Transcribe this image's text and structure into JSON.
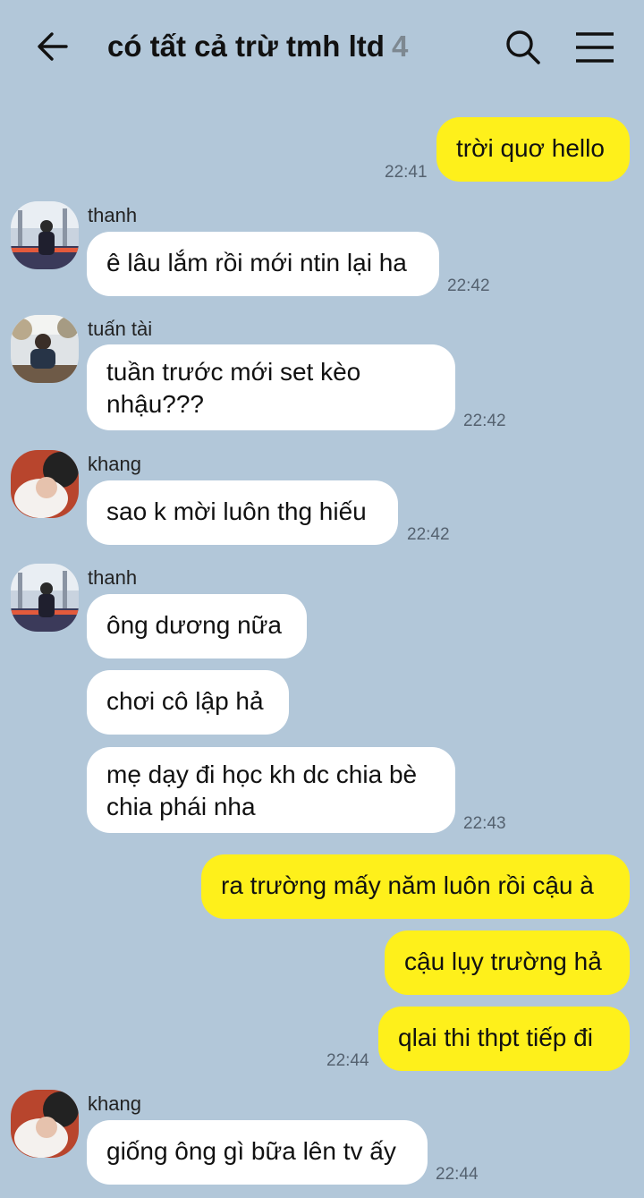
{
  "header": {
    "title": "có tất cả trừ tmh ltd",
    "member_count": "4"
  },
  "messages": [
    {
      "sender": "",
      "text": "trời quơ hello",
      "time": "22:41"
    },
    {
      "sender": "thanh",
      "text": "ê lâu lắm rồi mới ntin lại ha",
      "time": "22:42"
    },
    {
      "sender": "tuấn tài",
      "text": "tuần trước mới set kèo\nnhậu???",
      "time": "22:42"
    },
    {
      "sender": "khang",
      "text": "sao k mời luôn thg hiếu",
      "time": "22:42"
    },
    {
      "sender": "thanh",
      "text": "ông dương nữa",
      "time": ""
    },
    {
      "sender": "",
      "text": "chơi cô lập hả",
      "time": ""
    },
    {
      "sender": "",
      "text": "mẹ dạy đi học kh dc chia bè\nchia phái nha",
      "time": "22:43"
    },
    {
      "sender": "",
      "text": "ra trường mấy năm luôn rồi cậu à",
      "time": ""
    },
    {
      "sender": "",
      "text": "cậu lụy trường hả",
      "time": ""
    },
    {
      "sender": "",
      "text": "qlai thi thpt tiếp đi",
      "time": "22:44"
    },
    {
      "sender": "khang",
      "text": "giống ông gì bữa lên tv ấy",
      "time": "22:44"
    }
  ],
  "icons": [
    "back-arrow-icon",
    "search-icon",
    "menu-icon"
  ],
  "colors": {
    "background": "#b2c7d9",
    "outgoing": "#fef01b",
    "incoming": "#ffffff"
  }
}
